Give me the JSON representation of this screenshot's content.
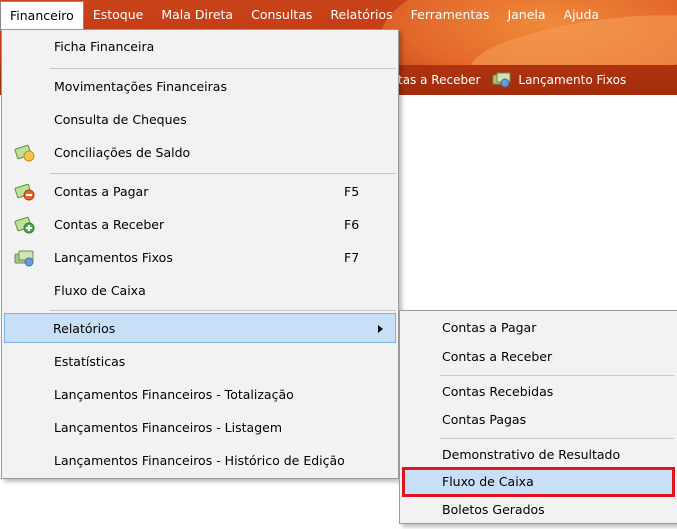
{
  "menubar": {
    "items": [
      {
        "label": "Financeiro",
        "active": true
      },
      {
        "label": "Estoque",
        "active": false
      },
      {
        "label": "Mala Direta",
        "active": false
      },
      {
        "label": "Consultas",
        "active": false
      },
      {
        "label": "Relatórios",
        "active": false
      },
      {
        "label": "Ferramentas",
        "active": false
      },
      {
        "label": "Janela",
        "active": false
      },
      {
        "label": "Ajuda",
        "active": false
      }
    ]
  },
  "toolbar": {
    "partial_label": "tas a Receber",
    "fixos_label": "Lançamento Fixos"
  },
  "menu": {
    "ficha": "Ficha Financeira",
    "movimentacoes": "Movimentações Financeiras",
    "cheques": "Consulta de Cheques",
    "conciliacoes": "Conciliações de Saldo",
    "contas_pagar": "Contas a Pagar",
    "contas_pagar_key": "F5",
    "contas_receber": "Contas a Receber",
    "contas_receber_key": "F6",
    "lancamentos_fixos": "Lançamentos Fixos",
    "lancamentos_fixos_key": "F7",
    "fluxo": "Fluxo de Caixa",
    "relatorios": "Relatórios",
    "estatisticas": "Estatísticas",
    "lanc_totalizacao": "Lançamentos Financeiros - Totalização",
    "lanc_listagem": "Lançamentos Financeiros - Listagem",
    "lanc_historico": "Lançamentos Financeiros - Histórico de Edição"
  },
  "submenu": {
    "contas_pagar": "Contas a Pagar",
    "contas_receber": "Contas a Receber",
    "contas_recebidas": "Contas Recebidas",
    "contas_pagas": "Contas Pagas",
    "demonstrativo": "Demonstrativo de Resultado",
    "fluxo": "Fluxo de Caixa",
    "boletos": "Boletos Gerados"
  },
  "colors": {
    "banner": "#c23a14",
    "highlight": "#c7dff7",
    "highlight_border": "#7fb2e5",
    "callout": "#e3141d"
  }
}
